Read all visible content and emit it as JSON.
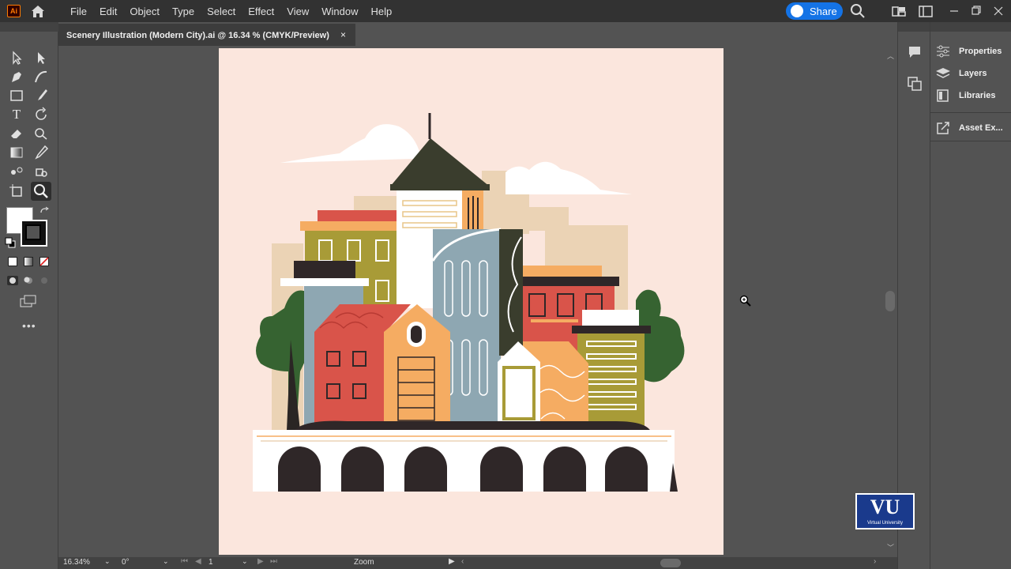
{
  "app": {
    "logo_text": "Ai"
  },
  "menu": {
    "items": [
      "File",
      "Edit",
      "Object",
      "Type",
      "Select",
      "Effect",
      "View",
      "Window",
      "Help"
    ]
  },
  "share": {
    "label": "Share"
  },
  "document": {
    "tab_title": "Scenery Illustration (Modern City).ai @ 16.34 % (CMYK/Preview)",
    "close": "×"
  },
  "status": {
    "zoom": "16.34%",
    "rotation": "0°",
    "artboard": "1",
    "mode": "Zoom"
  },
  "panels": {
    "items": [
      {
        "label": "Properties",
        "icon": "properties-icon"
      },
      {
        "label": "Layers",
        "icon": "layers-icon"
      },
      {
        "label": "Libraries",
        "icon": "libraries-icon"
      },
      {
        "label": "Asset Ex...",
        "icon": "asset-export-icon"
      }
    ]
  },
  "watermark": {
    "text": "VU",
    "subtitle": "Virtual University"
  },
  "colors": {
    "artboard": "#fbe6dd",
    "accent": "#1473e6",
    "brand": "#ff7c00"
  }
}
